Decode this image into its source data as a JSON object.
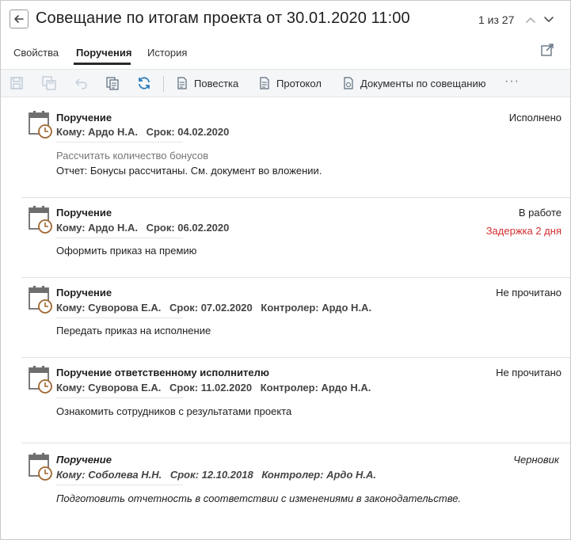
{
  "header": {
    "title": "Совещание по итогам проекта от 30.01.2020 11:00",
    "pager": "1 из 27"
  },
  "tabs": [
    {
      "label": "Свойства"
    },
    {
      "label": "Поручения"
    },
    {
      "label": "История"
    }
  ],
  "toolbar": {
    "agenda": "Повестка",
    "protocol": "Протокол",
    "docs": "Документы по совещанию",
    "more": "···"
  },
  "colors": {
    "accent": "#2a7ab8",
    "delay": "#d32f2f",
    "icon_brown": "#a0672e"
  },
  "items": [
    {
      "title": "Поручение",
      "to": "Кому: Ардо Н.А.",
      "due": "Срок: 04.02.2020",
      "controller": "",
      "subject": "Рассчитать количество бонусов",
      "desc": "Отчет: Бонусы рассчитаны. См. документ во вложении.",
      "status": "Исполнено",
      "delay": ""
    },
    {
      "title": "Поручение",
      "to": "Кому: Ардо Н.А.",
      "due": "Срок: 06.02.2020",
      "controller": "",
      "subject": "",
      "desc": "Оформить приказ на премию",
      "status": "В работе",
      "delay": "Задержка 2 дня"
    },
    {
      "title": "Поручение",
      "to": "Кому: Суворова Е.А.",
      "due": "Срок: 07.02.2020",
      "controller": "Контролер: Ардо Н.А.",
      "subject": "",
      "desc": "Передать приказ на исполнение",
      "status": "Не прочитано",
      "delay": ""
    },
    {
      "title": "Поручение ответственному исполнителю",
      "to": "Кому: Суворова Е.А.",
      "due": "Срок: 11.02.2020",
      "controller": "Контролер: Ардо Н.А.",
      "subject": "",
      "desc": "Ознакомить сотрудников с результатами проекта",
      "status": "Не прочитано",
      "delay": ""
    },
    {
      "title": "Поручение",
      "to": "Кому: Соболева Н.Н.",
      "due": "Срок: 12.10.2018",
      "controller": "Контролер: Ардо Н.А.",
      "subject": "",
      "desc": "Подготовить отчетность в соответствии с изменениями в законодательстве.",
      "status": "Черновик",
      "delay": ""
    }
  ]
}
